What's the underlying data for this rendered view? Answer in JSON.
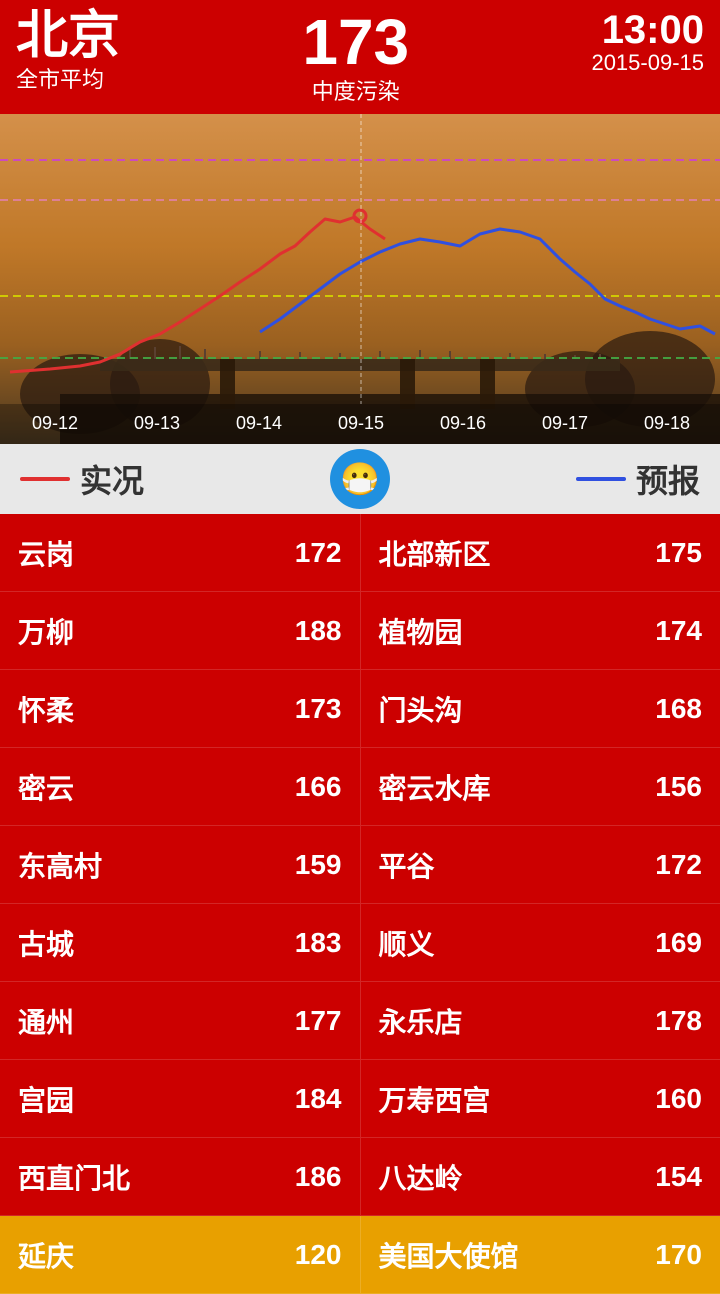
{
  "header": {
    "city": "北京",
    "city_sub": "全市平均",
    "aqi_value": "173",
    "aqi_label": "中度污染",
    "time": "13:00",
    "date": "2015-09-15"
  },
  "chart": {
    "x_labels": [
      "09-12",
      "09-13",
      "09-14",
      "09-15",
      "09-16",
      "09-17",
      "09-18"
    ],
    "threshold_lines": [
      {
        "label": "紫色线",
        "y_pct": 14,
        "color": "#cc44cc",
        "dash": "6,4"
      },
      {
        "label": "粉色线",
        "y_pct": 26,
        "color": "#e080a0",
        "dash": "6,4"
      },
      {
        "label": "黄色线",
        "y_pct": 55,
        "color": "#d4d400",
        "dash": "6,4"
      },
      {
        "label": "绿色线",
        "y_pct": 74,
        "color": "#44aa44",
        "dash": "6,4"
      }
    ]
  },
  "legend": {
    "actual_label": "实况",
    "forecast_label": "预报",
    "face_icon": "😷"
  },
  "stations": [
    {
      "left_name": "云岗",
      "left_val": "172",
      "right_name": "北部新区",
      "right_val": "175",
      "highlight": false
    },
    {
      "left_name": "万柳",
      "left_val": "188",
      "right_name": "植物园",
      "right_val": "174",
      "highlight": false
    },
    {
      "left_name": "怀柔",
      "left_val": "173",
      "right_name": "门头沟",
      "right_val": "168",
      "highlight": false
    },
    {
      "left_name": "密云",
      "left_val": "166",
      "right_name": "密云水库",
      "right_val": "156",
      "highlight": false
    },
    {
      "left_name": "东高村",
      "left_val": "159",
      "right_name": "平谷",
      "right_val": "172",
      "highlight": false
    },
    {
      "left_name": "古城",
      "left_val": "183",
      "right_name": "顺义",
      "right_val": "169",
      "highlight": false
    },
    {
      "left_name": "通州",
      "left_val": "177",
      "right_name": "永乐店",
      "right_val": "178",
      "highlight": false
    },
    {
      "left_name": "宫园",
      "left_val": "184",
      "right_name": "万寿西宫",
      "right_val": "160",
      "highlight": false
    },
    {
      "left_name": "西直门北",
      "left_val": "186",
      "right_name": "八达岭",
      "right_val": "154",
      "highlight": false
    },
    {
      "left_name": "延庆",
      "left_val": "120",
      "right_name": "美国大使馆",
      "right_val": "170",
      "highlight": true
    }
  ]
}
